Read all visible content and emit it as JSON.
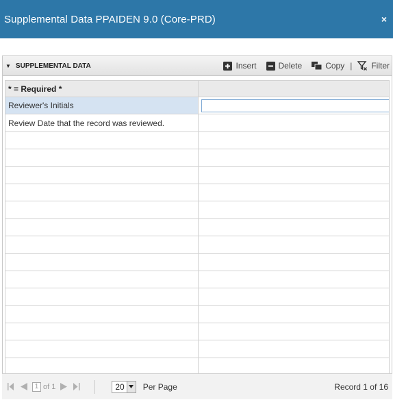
{
  "window": {
    "title": "Supplemental Data PPAIDEN 9.0 (Core-PRD)",
    "close_glyph": "×"
  },
  "section": {
    "title": "SUPPLEMENTAL DATA",
    "collapse_glyph": "▼"
  },
  "toolbar": {
    "insert_label": "Insert",
    "delete_label": "Delete",
    "copy_label": "Copy",
    "separator": "|",
    "filter_label": "Filter"
  },
  "grid": {
    "header": "* = Required *",
    "rows": [
      {
        "label": "Reviewer's Initials",
        "value": "",
        "selected": true
      },
      {
        "label": "Review Date that the record was reviewed.",
        "value": ""
      }
    ],
    "empty_rows": 15
  },
  "pager": {
    "current_page": "1",
    "of_text": "of 1",
    "page_size": "20",
    "per_page_label": "Per Page",
    "record_text": "Record 1 of 16"
  },
  "colors": {
    "titlebar": "#2d77a8",
    "selected_row": "#d5e3f2"
  }
}
